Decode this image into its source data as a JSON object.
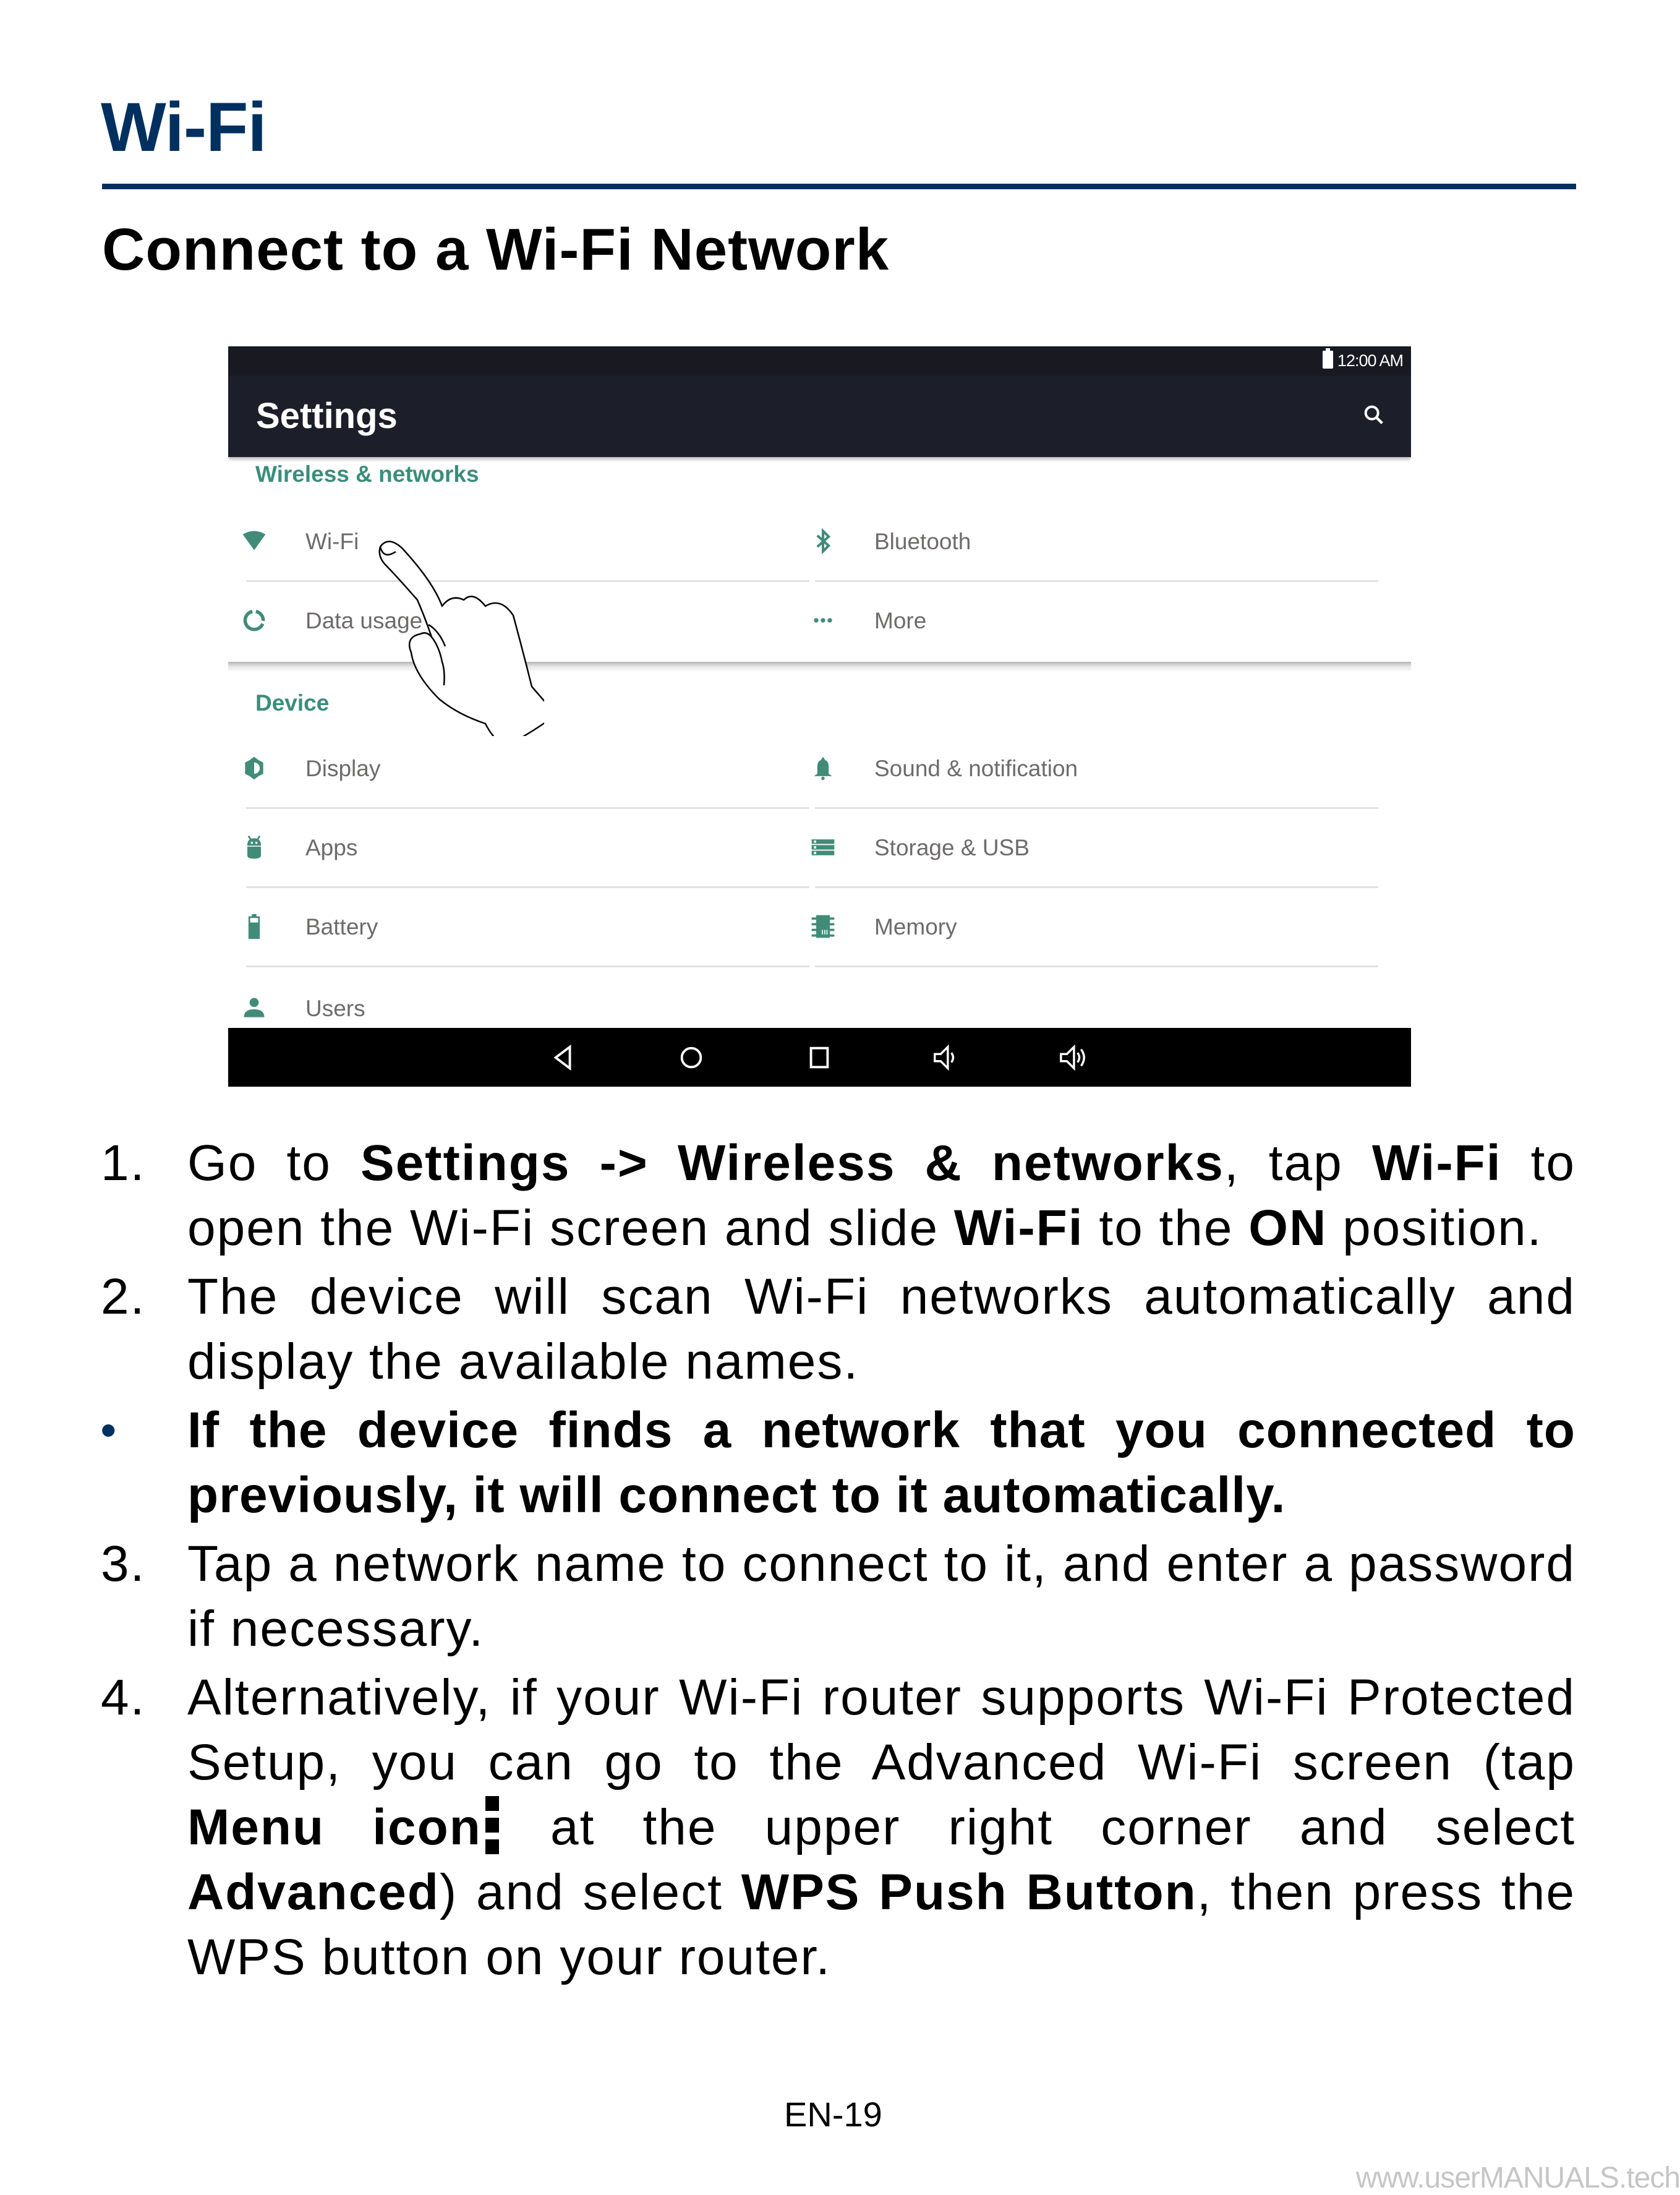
{
  "page": {
    "heading": "Wi-Fi",
    "subheading": "Connect to a Wi-Fi Network",
    "page_number": "EN-19",
    "watermark": "www.userMANUALS.tech"
  },
  "screenshot": {
    "status_bar": {
      "time": "12:00 AM",
      "battery_icon": "battery-full-icon"
    },
    "app_bar": {
      "title": "Settings",
      "search_icon": "search-icon"
    },
    "accent_color": "#3a8d7c",
    "sections": [
      {
        "title": "Wireless & networks",
        "items": [
          {
            "label": "Wi-Fi",
            "icon": "wifi-icon"
          },
          {
            "label": "Bluetooth",
            "icon": "bluetooth-icon"
          },
          {
            "label": "Data usage",
            "icon": "data-usage-icon"
          },
          {
            "label": "More",
            "icon": "more-dots-icon"
          }
        ]
      },
      {
        "title": "Device",
        "items": [
          {
            "label": "Display",
            "icon": "brightness-icon"
          },
          {
            "label": "Sound & notification",
            "icon": "bell-icon"
          },
          {
            "label": "Apps",
            "icon": "android-icon"
          },
          {
            "label": "Storage & USB",
            "icon": "storage-icon"
          },
          {
            "label": "Battery",
            "icon": "battery-icon"
          },
          {
            "label": "Memory",
            "icon": "memory-chip-icon"
          },
          {
            "label": "Users",
            "icon": "person-icon"
          }
        ]
      }
    ],
    "nav_bar": [
      "back-icon",
      "home-icon",
      "recents-icon",
      "volume-down-icon",
      "volume-up-icon"
    ]
  },
  "steps": [
    {
      "marker": "1.",
      "parts": [
        {
          "t": "Go to "
        },
        {
          "t": "Settings -> Wireless & networks",
          "b": true
        },
        {
          "t": ", tap "
        },
        {
          "t": "Wi-Fi",
          "b": true
        },
        {
          "t": " to open the Wi-Fi screen and slide "
        },
        {
          "t": "Wi-Fi",
          "b": true
        },
        {
          "t": " to the "
        },
        {
          "t": "ON",
          "b": true
        },
        {
          "t": " position."
        }
      ]
    },
    {
      "marker": "2.",
      "parts": [
        {
          "t": "The device will scan Wi-Fi networks automatically and display the available names."
        }
      ]
    },
    {
      "marker": "•",
      "bullet": true,
      "parts": [
        {
          "t": "If the device finds a network that you connected to previously, it will connect to it automatically."
        }
      ]
    },
    {
      "marker": "3.",
      "parts": [
        {
          "t": "Tap a network name to connect to it, and enter a password if necessary."
        }
      ]
    },
    {
      "marker": "4.",
      "parts": [
        {
          "t": "Alternatively, if your Wi-Fi router supports Wi-Fi Protected Setup, you can go to the Advanced Wi-Fi screen (tap "
        },
        {
          "t": "Menu icon",
          "b": true
        },
        {
          "icon": "menu-vertical-dots-icon"
        },
        {
          "t": " at the upper right corner and select "
        },
        {
          "t": "Advanced",
          "b": true
        },
        {
          "t": ") and select "
        },
        {
          "t": "WPS Push Button",
          "b": true
        },
        {
          "t": ", then press the WPS button on your router."
        }
      ]
    }
  ]
}
